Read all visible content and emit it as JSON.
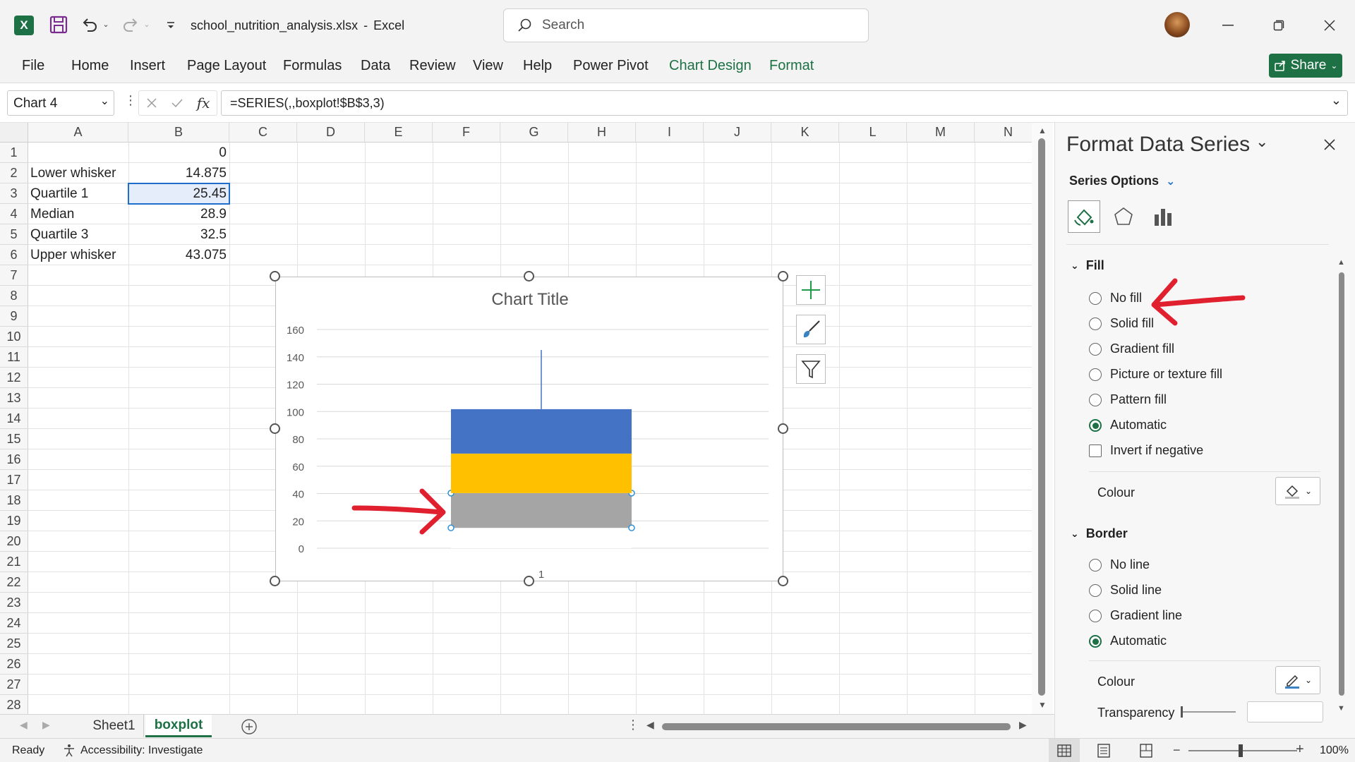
{
  "titlebar": {
    "filename": "school_nutrition_analysis.xlsx",
    "separator": "-",
    "app": "Excel",
    "search_placeholder": "Search"
  },
  "menu": [
    "File",
    "Home",
    "Insert",
    "Page Layout",
    "Formulas",
    "Data",
    "Review",
    "View",
    "Help",
    "Power Pivot",
    "Chart Design",
    "Format"
  ],
  "share_label": "Share",
  "formula_bar": {
    "name_box": "Chart 4",
    "formula": "=SERIES(,,boxplot!$B$3,3)"
  },
  "columns": [
    "A",
    "B",
    "C",
    "D",
    "E",
    "F",
    "G",
    "H",
    "I",
    "J",
    "K",
    "L",
    "M",
    "N"
  ],
  "rows": [
    "1",
    "2",
    "3",
    "4",
    "5",
    "6",
    "7",
    "8",
    "9",
    "10",
    "11",
    "12",
    "13",
    "14",
    "15",
    "16",
    "17",
    "18",
    "19",
    "20",
    "21",
    "22",
    "23",
    "24",
    "25",
    "26",
    "27",
    "28"
  ],
  "cells": {
    "b1": "0",
    "a2": "Lower whisker",
    "b2": "14.875",
    "a3": "Quartile 1",
    "b3": "25.45",
    "a4": "Median",
    "b4": "28.9",
    "a5": "Quartile 3",
    "b5": "32.5",
    "a6": "Upper whisker",
    "b6": "43.075"
  },
  "chart": {
    "title": "Chart Title",
    "y_ticks": [
      "160",
      "140",
      "120",
      "100",
      "80",
      "60",
      "40",
      "20",
      "0"
    ],
    "x_label": "1"
  },
  "chart_data": {
    "type": "bar",
    "stacked": true,
    "categories": [
      "1"
    ],
    "series": [
      {
        "values": [
          14.875
        ],
        "color": "#ffffff"
      },
      {
        "values": [
          25.45
        ],
        "color": "#a5a5a5"
      },
      {
        "values": [
          28.9
        ],
        "color": "#ffc000"
      },
      {
        "values": [
          32.5
        ],
        "color": "#4472c4"
      }
    ],
    "error_bar_top": 145,
    "ylim": [
      0,
      160
    ],
    "title": "Chart Title",
    "grid": true
  },
  "pane": {
    "title": "Format Data Series",
    "series_options": "Series Options",
    "fill_header": "Fill",
    "fill_options": [
      "No fill",
      "Solid fill",
      "Gradient fill",
      "Picture or texture fill",
      "Pattern fill",
      "Automatic"
    ],
    "invert_label": "Invert if negative",
    "colour_label": "Colour",
    "border_header": "Border",
    "border_options": [
      "No line",
      "Solid line",
      "Gradient line",
      "Automatic"
    ],
    "border_colour_label": "Colour",
    "transparency_label": "Transparency"
  },
  "sheets": [
    "Sheet1",
    "boxplot"
  ],
  "status": {
    "ready": "Ready",
    "accessibility": "Accessibility: Investigate",
    "zoom": "100%"
  },
  "colors": {
    "excel_green": "#1e7145",
    "annotation_red": "#e0202e",
    "selection_blue": "#1f6ecb"
  }
}
